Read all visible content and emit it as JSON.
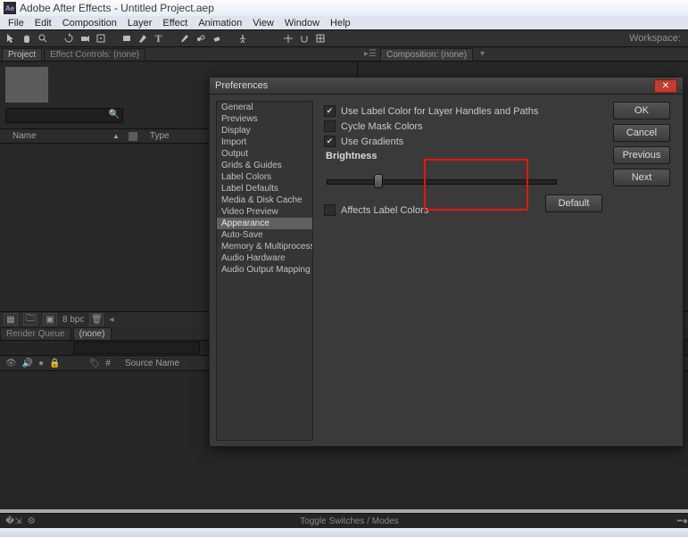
{
  "window": {
    "title": "Adobe After Effects - Untitled Project.aep",
    "badge": "Ae"
  },
  "menus": [
    "File",
    "Edit",
    "Composition",
    "Layer",
    "Effect",
    "Animation",
    "View",
    "Window",
    "Help"
  ],
  "workspace_label": "Workspace:",
  "panel_tabs": {
    "project": "Project",
    "effect_controls": "Effect Controls: (none)"
  },
  "comp_panel": {
    "label": "Composition: (none)",
    "dropdown": "▾"
  },
  "project_columns": {
    "name": "Name",
    "type": "Type",
    "sort_glyph": "▲"
  },
  "proj_footer": {
    "bits": "8 bpc"
  },
  "timeline": {
    "tabs": {
      "render_queue": "Render Queue",
      "none": "(none)"
    },
    "header_columns": {
      "src": "Source Name",
      "lock_glyph": "🔒",
      "tag_glyph": "🏷"
    }
  },
  "footer": {
    "toggle": "Toggle Switches / Modes"
  },
  "preferences": {
    "title": "Preferences",
    "categories": [
      "General",
      "Previews",
      "Display",
      "Import",
      "Output",
      "Grids & Guides",
      "Label Colors",
      "Label Defaults",
      "Media & Disk Cache",
      "Video Preview",
      "Appearance",
      "Auto-Save",
      "Memory & Multiprocessing",
      "Audio Hardware",
      "Audio Output Mapping"
    ],
    "selected_index": 10,
    "options": {
      "use_label_color": {
        "label": "Use Label Color for Layer Handles and Paths",
        "checked": true
      },
      "cycle_mask": {
        "label": "Cycle Mask Colors",
        "checked": false
      },
      "use_gradients": {
        "label": "Use Gradients",
        "checked": true
      },
      "affects_label": {
        "label": "Affects Label Colors",
        "checked": false
      }
    },
    "brightness_label": "Brightness",
    "default_btn": "Default",
    "buttons": {
      "ok": "OK",
      "cancel": "Cancel",
      "previous": "Previous",
      "next": "Next"
    },
    "close_glyph": "✕"
  }
}
